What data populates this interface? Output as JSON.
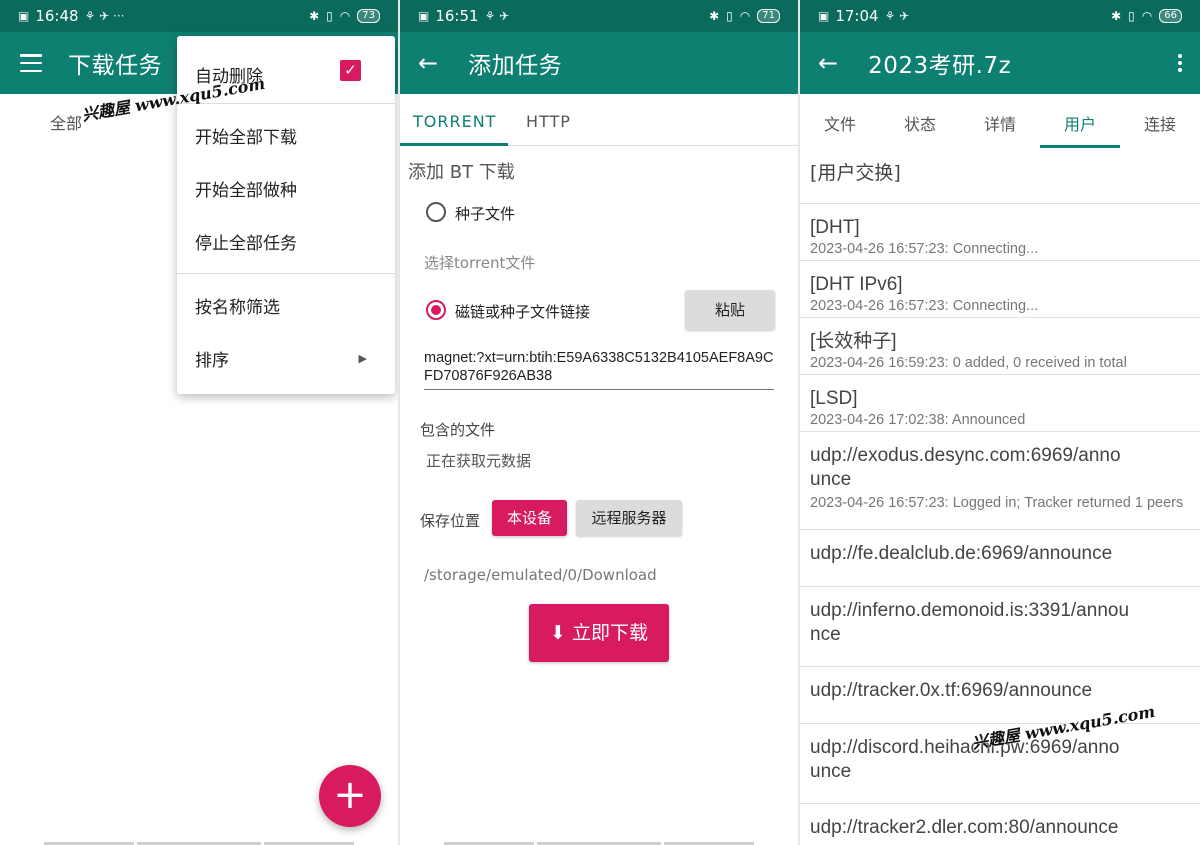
{
  "watermark": "兴趣屋 www.xqu5.com",
  "panel1": {
    "status": {
      "time": "16:48",
      "extra": "⚘ ✈ ···",
      "battery": "73"
    },
    "title": "下载任务",
    "tab_all": "全部",
    "menu": {
      "auto_item": "自动删除",
      "items": [
        "开始全部下载",
        "开始全部做种",
        "停止全部任务",
        "按名称筛选",
        "排序"
      ]
    },
    "fab": "+"
  },
  "panel2": {
    "status": {
      "time": "16:51",
      "extra": "⚘ ✈",
      "battery": "71"
    },
    "title": "添加任务",
    "tabs": [
      "TORRENT",
      "HTTP"
    ],
    "heading": "添加 BT 下载",
    "radio_torrent": "种子文件",
    "select_torrent": "选择torrent文件",
    "radio_magnet": "磁链或种子文件链接",
    "paste": "粘贴",
    "magnet": "magnet:?xt=urn:btih:E59A6338C5132B4105AEF8A9CFD70876F926AB38",
    "files_label": "包含的文件",
    "fetching": "正在获取元数据",
    "save_label": "保存位置",
    "btn_device": "本设备",
    "btn_remote": "远程服务器",
    "path": "/storage/emulated/0/Download",
    "download": "立即下载"
  },
  "panel3": {
    "status": {
      "time": "17:04",
      "extra": "⚘ ✈",
      "battery": "66"
    },
    "title": "2023考研.7z",
    "tabs": [
      "文件",
      "状态",
      "详情",
      "用户",
      "连接"
    ],
    "peer_exchange": "[用户交换]",
    "rows": [
      {
        "name": "[DHT]",
        "info": "2023-04-26 16:57:23: Connecting..."
      },
      {
        "name": "[DHT IPv6]",
        "info": "2023-04-26 16:57:23: Connecting..."
      },
      {
        "name": "[长效种子]",
        "info": "2023-04-26 16:59:23: 0 added, 0 received in total"
      },
      {
        "name": "[LSD]",
        "info": "2023-04-26 17:02:38: Announced"
      },
      {
        "name": "udp://exodus.desync.com:6969/announce",
        "info": "2023-04-26 16:57:23: Logged in; Tracker returned 1 peers"
      },
      {
        "name": "udp://fe.dealclub.de:6969/announce",
        "info": ""
      },
      {
        "name": "udp://inferno.demonoid.is:3391/announce",
        "info": ""
      },
      {
        "name": "udp://tracker.0x.tf:6969/announce",
        "info": ""
      },
      {
        "name": "udp://discord.heihachi.pw:6969/announce",
        "info": ""
      },
      {
        "name": "udp://tracker2.dler.com:80/announce",
        "info": ""
      }
    ]
  },
  "colors": {
    "teal": "#0d8071",
    "dark_teal": "#0a6b5c",
    "pink": "#d81b60"
  }
}
